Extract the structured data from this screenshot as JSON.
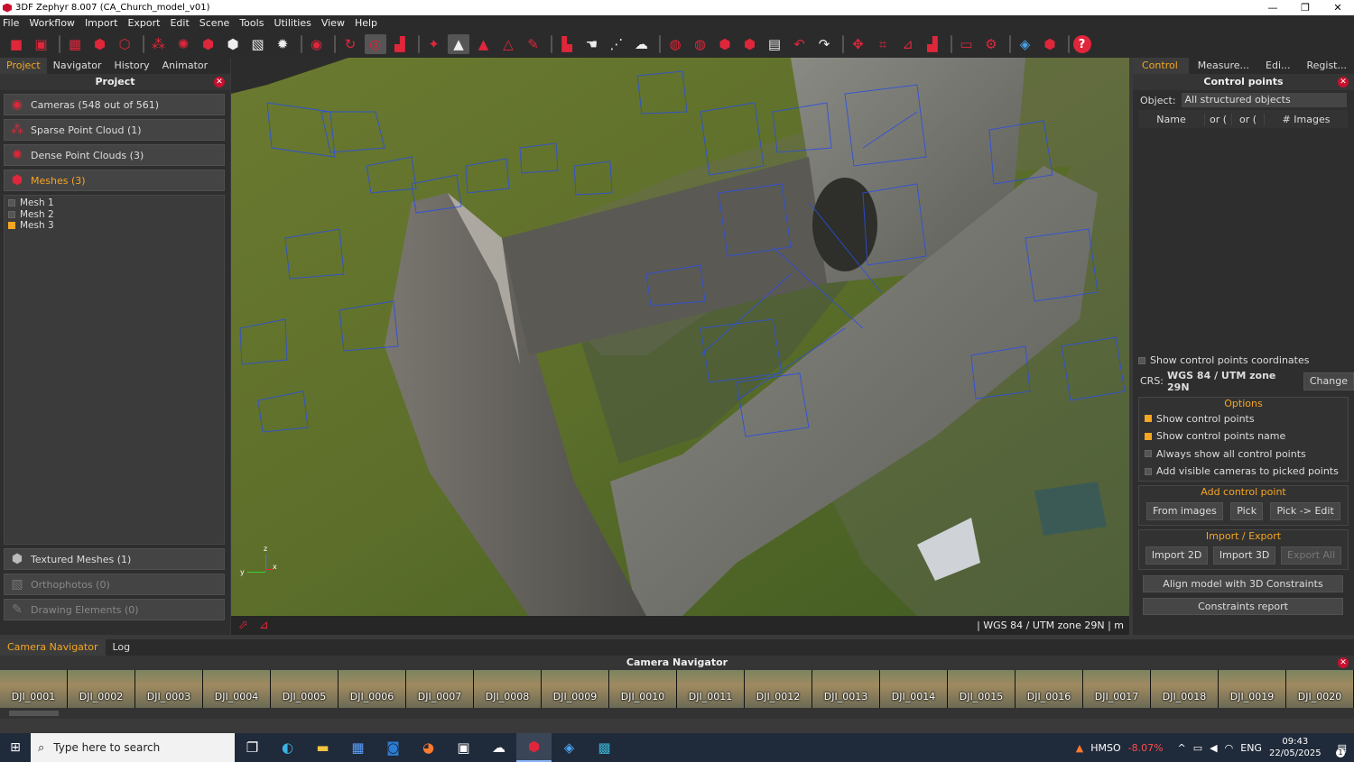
{
  "window": {
    "title": "3DF Zephyr 8.007 (CA_Church_model_v01)",
    "controls": [
      "—",
      "❐",
      "✕"
    ]
  },
  "menu": [
    "File",
    "Workflow",
    "Import",
    "Export",
    "Edit",
    "Scene",
    "Tools",
    "Utilities",
    "View",
    "Help"
  ],
  "left_panel": {
    "tabs": [
      "Project",
      "Navigator",
      "History",
      "Animator"
    ],
    "active_tab": "Project",
    "title": "Project",
    "sections": {
      "cameras": "Cameras (548 out of 561)",
      "sparse": "Sparse Point Cloud (1)",
      "dense": "Dense Point Clouds (3)",
      "meshes": "Meshes (3)",
      "textured": "Textured Meshes (1)",
      "ortho": "Orthophotos (0)",
      "drawing": "Drawing Elements (0)"
    },
    "mesh_items": [
      {
        "label": "Mesh 1",
        "checked": false
      },
      {
        "label": "Mesh 2",
        "checked": false
      },
      {
        "label": "Mesh 3",
        "checked": true
      }
    ]
  },
  "viewport": {
    "axis": {
      "z": "z",
      "y": "y",
      "x": "x"
    },
    "status": "| WGS 84 / UTM zone 29N   | m"
  },
  "right_panel": {
    "tabs": [
      "Control ...",
      "Measure...",
      "Edi...",
      "Regist..."
    ],
    "active_tab": "Control ...",
    "title": "Control points",
    "object_label": "Object:",
    "object_value": "All structured objects",
    "columns": [
      "Name",
      "or (",
      "or (",
      "# Images"
    ],
    "show_coords": "Show control points coordinates",
    "crs_label": "CRS:",
    "crs_value": "WGS 84 / UTM zone 29N",
    "change": "Change",
    "options_title": "Options",
    "options": [
      {
        "label": "Show control points",
        "checked": true
      },
      {
        "label": "Show control points name",
        "checked": true
      },
      {
        "label": "Always show all control points",
        "checked": false
      },
      {
        "label": "Add visible cameras to picked points",
        "checked": false
      }
    ],
    "add_title": "Add control point",
    "add_buttons": [
      "From images",
      "Pick",
      "Pick -> Edit"
    ],
    "io_title": "Import / Export",
    "io_buttons": [
      "Import 2D",
      "Import 3D",
      "Export All"
    ],
    "align": "Align model with 3D Constraints",
    "report": "Constraints report"
  },
  "bottom": {
    "tabs": [
      "Camera Navigator",
      "Log"
    ],
    "active_tab": "Camera Navigator",
    "title": "Camera Navigator",
    "thumbnails": [
      "DJI_0001",
      "DJI_0002",
      "DJI_0003",
      "DJI_0004",
      "DJI_0005",
      "DJI_0006",
      "DJI_0007",
      "DJI_0008",
      "DJI_0009",
      "DJI_0010",
      "DJI_0011",
      "DJI_0012",
      "DJI_0013",
      "DJI_0014",
      "DJI_0015",
      "DJI_0016",
      "DJI_0017",
      "DJI_0018",
      "DJI_0019",
      "DJI_0020"
    ]
  },
  "taskbar": {
    "search_placeholder": "Type here to search",
    "stock_name": "HMSO",
    "stock_change": "-8.07%",
    "lang": "ENG",
    "time": "09:43",
    "date": "22/05/2025",
    "notif": "1"
  },
  "colors": {
    "accent": "#f5a623",
    "brand_red": "#c8102e",
    "stock_down": "#ff4d4d"
  }
}
